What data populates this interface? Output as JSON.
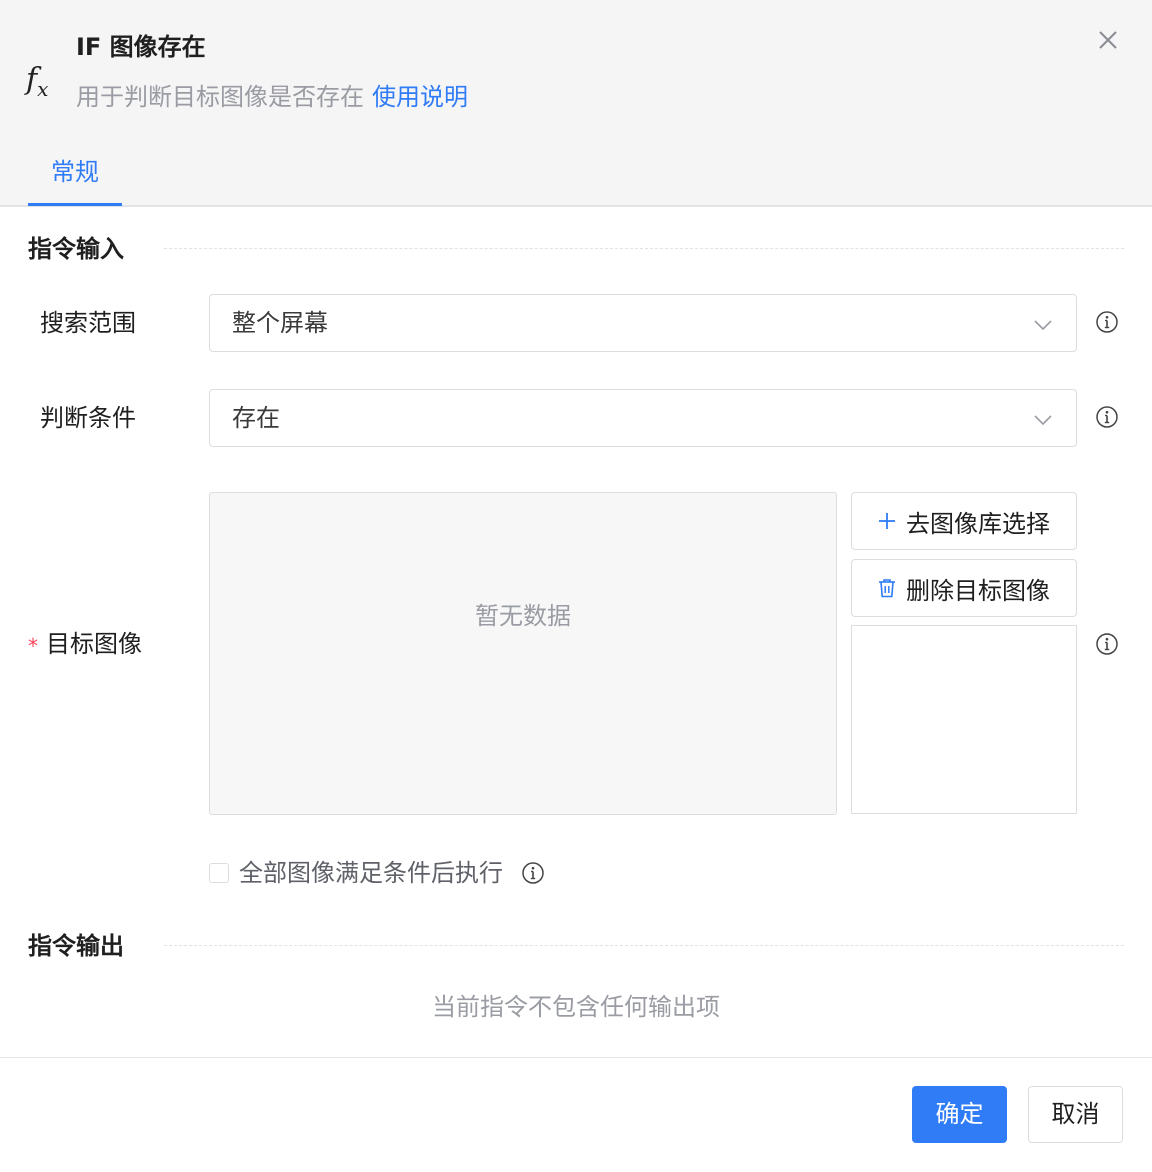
{
  "header": {
    "title": "IF 图像存在",
    "subtitle": "用于判断目标图像是否存在",
    "help_link": "使用说明",
    "icon": "fx-icon",
    "tab_general": "常规"
  },
  "input_section": {
    "title": "指令输入",
    "search_range": {
      "label": "搜索范围",
      "value": "整个屏幕"
    },
    "condition": {
      "label": "判断条件",
      "value": "存在"
    },
    "target_image": {
      "required_mark": "*",
      "label": "目标图像",
      "empty_text": "暂无数据",
      "select_button": "去图像库选择",
      "delete_button": "删除目标图像"
    },
    "all_images_checkbox": {
      "label": "全部图像满足条件后执行",
      "checked": false
    }
  },
  "output_section": {
    "title": "指令输出",
    "empty_text": "当前指令不包含任何输出项"
  },
  "footer": {
    "confirm": "确定",
    "cancel": "取消"
  },
  "colors": {
    "accent": "#2f7cf6",
    "header_bg": "#f5f5f6",
    "required": "#f5475a",
    "muted_text": "#9a9ca3"
  }
}
